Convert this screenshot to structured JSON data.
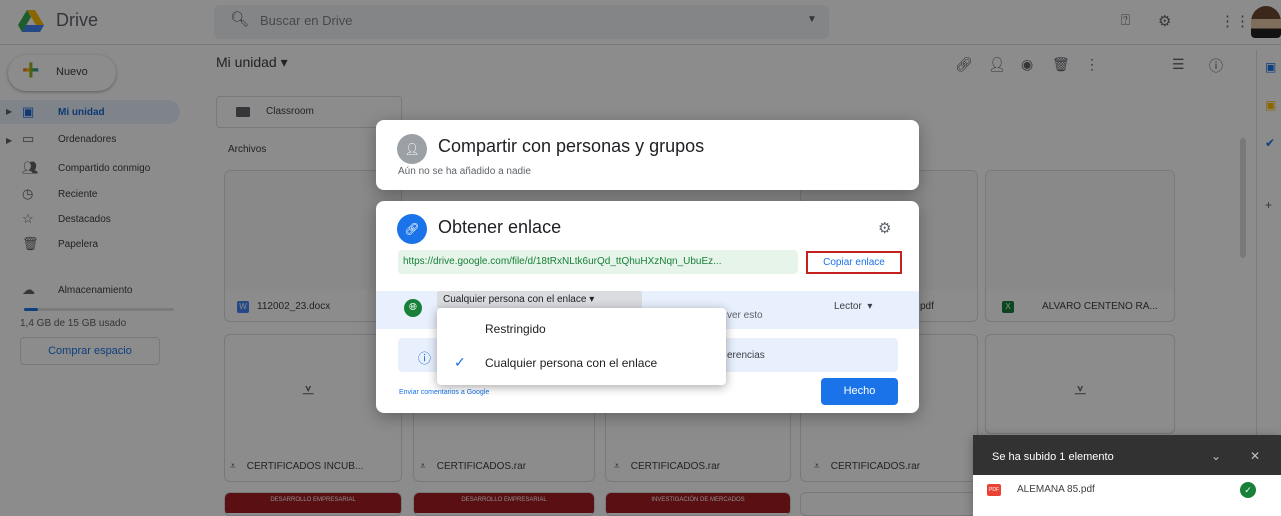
{
  "header": {
    "app_name": "Drive",
    "search_placeholder": "Buscar en Drive"
  },
  "sidebar": {
    "new_label": "Nuevo",
    "items": [
      {
        "label": "Mi unidad",
        "icon": "drive-icon"
      },
      {
        "label": "Ordenadores",
        "icon": "computer-icon"
      },
      {
        "label": "Compartido conmigo",
        "icon": "people-icon"
      },
      {
        "label": "Reciente",
        "icon": "clock-icon"
      },
      {
        "label": "Destacados",
        "icon": "star-icon"
      },
      {
        "label": "Papelera",
        "icon": "trash-icon"
      },
      {
        "label": "Almacenamiento",
        "icon": "cloud-icon"
      }
    ],
    "storage_text": "1,4 GB de 15 GB usado",
    "storage_fraction": 0.093,
    "buy_label": "Comprar espacio"
  },
  "main": {
    "title": "Mi unidad",
    "folder": "Classroom",
    "files_header": "Archivos",
    "files_row1": [
      {
        "name": "112002_23.docx",
        "type": "W"
      },
      {
        "name": "pdf"
      },
      {
        "name": "ALVARO CENTENO RA...",
        "type": "X"
      }
    ],
    "files_row2": [
      "CERTIFICADOS INCUB...",
      "CERTIFICADOS.rar",
      "CERTIFICADOS.rar",
      "CERTIFICADOS.rar"
    ],
    "files_row3": [
      "DESARROLLO EMPRESARIAL",
      "DESARROLLO EMPRESARIAL",
      "INVESTIGACIÓN DE MERCADOS"
    ]
  },
  "share_dialog": {
    "title": "Compartir con personas y grupos",
    "subtitle": "Aún no se ha añadido a nadie"
  },
  "link_dialog": {
    "title": "Obtener enlace",
    "url": "https://drive.google.com/file/d/18tRxNLtk6urQd_ttQhuHXzNqn_UbuEz...",
    "copy_label": "Copiar enlace",
    "access_value": "Cualquier persona con el enlace",
    "access_desc_partial": "ver esto",
    "role": "Lector",
    "info_partial": "erencias",
    "feedback": "Enviar comentarios a Google",
    "done_label": "Hecho",
    "menu_options": [
      "Restringido",
      "Cualquier persona con el enlace"
    ]
  },
  "toast": {
    "title": "Se ha subido 1 elemento",
    "file": "ALEMANA 85.pdf",
    "pdf_badge": "PDF"
  },
  "colors": {
    "accent": "#1a73e8",
    "link_green": "#188038",
    "highlight_red": "#c5221f"
  }
}
